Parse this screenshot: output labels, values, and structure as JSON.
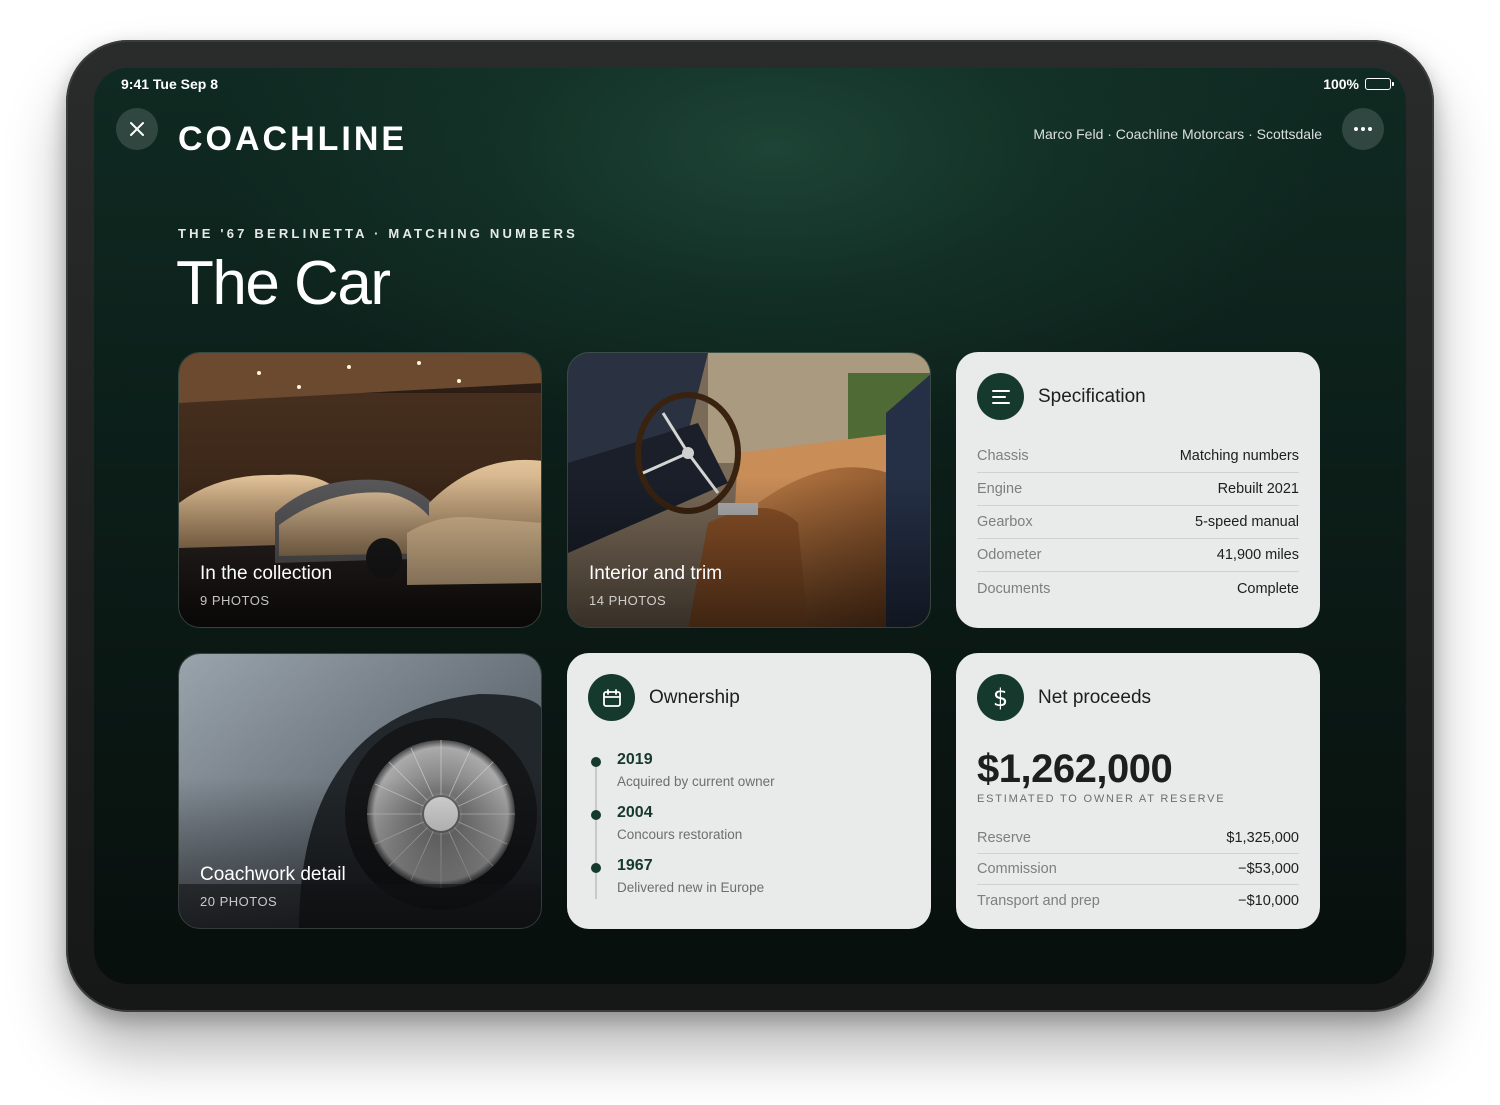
{
  "status_bar": {
    "time": "9:41  Tue Sep 8",
    "battery": "100%"
  },
  "header": {
    "brand": "COACHLINE",
    "agent": "Marco Feld · Coachline Motorcars · Scottsdale"
  },
  "hero": {
    "eyebrow": "THE '67 BERLINETTA · MATCHING NUMBERS",
    "title": "The Car"
  },
  "photos": [
    {
      "title": "In the collection",
      "count": "9 PHOTOS"
    },
    {
      "title": "Interior and trim",
      "count": "14 PHOTOS"
    },
    {
      "title": "Coachwork detail",
      "count": "20 PHOTOS"
    }
  ],
  "specification": {
    "title": "Specification",
    "icon": "list-icon",
    "rows": [
      {
        "label": "Chassis",
        "value": "Matching numbers"
      },
      {
        "label": "Engine",
        "value": "Rebuilt 2021"
      },
      {
        "label": "Gearbox",
        "value": "5-speed manual"
      },
      {
        "label": "Odometer",
        "value": "41,900 miles"
      },
      {
        "label": "Documents",
        "value": "Complete"
      }
    ]
  },
  "ownership": {
    "title": "Ownership",
    "icon": "calendar-icon",
    "events": [
      {
        "year": "2019",
        "text": "Acquired by current owner"
      },
      {
        "year": "2004",
        "text": "Concours restoration"
      },
      {
        "year": "1967",
        "text": "Delivered new in Europe"
      }
    ]
  },
  "proceeds": {
    "title": "Net proceeds",
    "icon": "dollar-icon",
    "amount": "$1,262,000",
    "caption": "ESTIMATED TO OWNER AT RESERVE",
    "rows": [
      {
        "label": "Reserve",
        "value": "$1,325,000"
      },
      {
        "label": "Commission",
        "value": "−$53,000"
      },
      {
        "label": "Transport and prep",
        "value": "−$10,000"
      }
    ]
  },
  "colors": {
    "accent": "#16392d",
    "card": "#e9eaea",
    "background": "#0c1d18"
  }
}
